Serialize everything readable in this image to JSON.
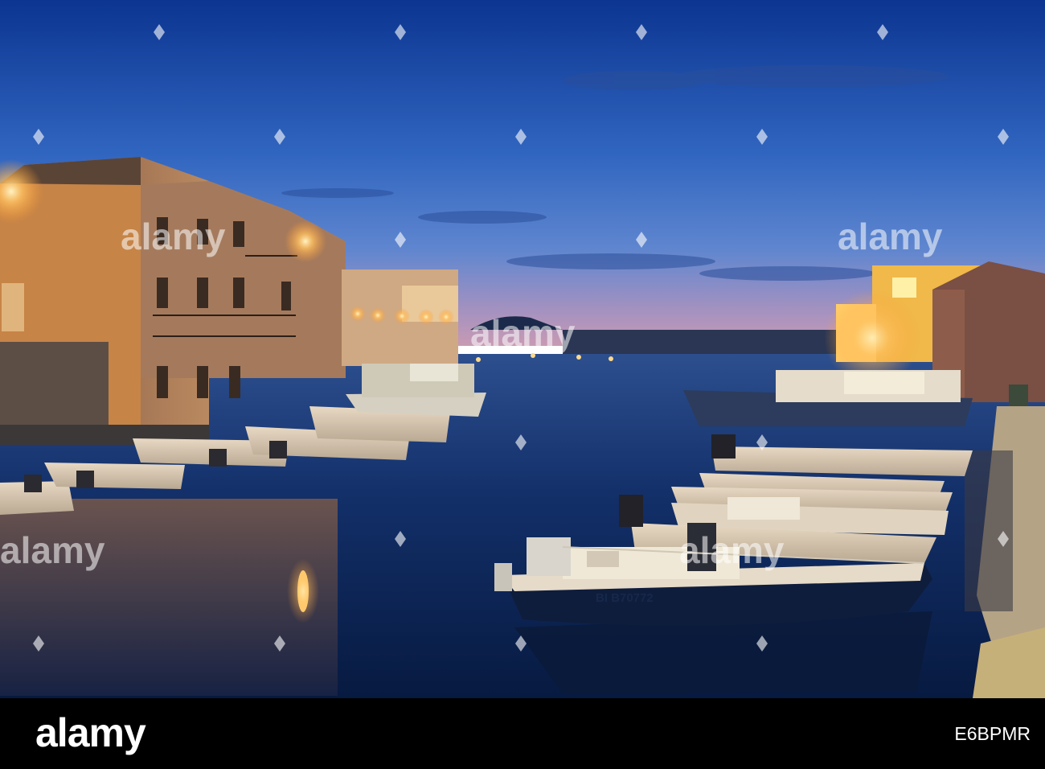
{
  "photo": {
    "description_colors": {
      "sky_top": "#0d3b9a",
      "sky_mid": "#3a6cc6",
      "sky_horizon": "#c79ab8",
      "water": "#0f2858",
      "lamp_glow": "#ffb347",
      "building_lit": "#d9944f"
    },
    "boat_registration": "BI B70772",
    "watermark_word": "alamy"
  },
  "footer": {
    "logo": "alamy",
    "image_id": "E6BPMR"
  }
}
